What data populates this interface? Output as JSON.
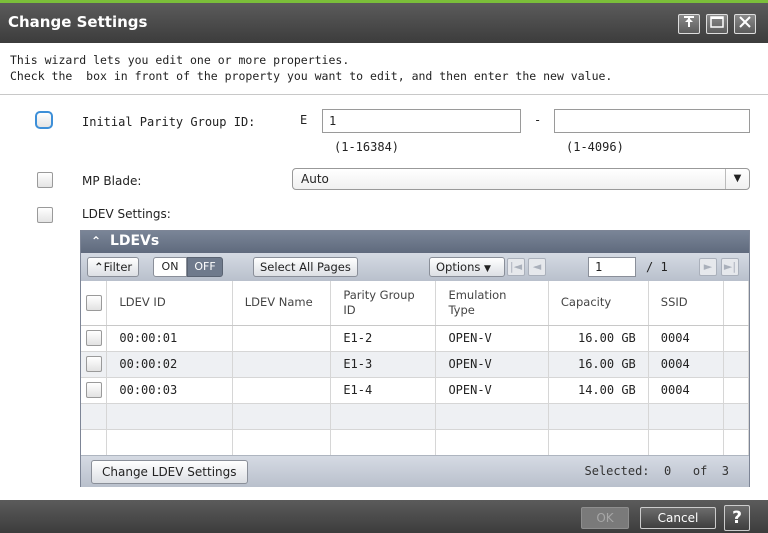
{
  "window": {
    "title": "Change Settings",
    "pin_icon": "pin-icon",
    "maximize_icon": "maximize-icon",
    "close_icon": "close-icon",
    "accent_color": "#7bbf3a"
  },
  "intro": {
    "line1": "This wizard lets you edit one or more properties.",
    "line2": "Check the  box in front of the property you want to edit, and then enter the new value."
  },
  "parity": {
    "label": "Initial Parity Group ID:",
    "prefix": "E",
    "first_value": "1",
    "first_range": "(1-16384)",
    "separator": "-",
    "second_value": "",
    "second_range": "(1-4096)"
  },
  "mp_blade": {
    "label": "MP Blade:",
    "value": "Auto"
  },
  "ldev_settings": {
    "label": "LDEV Settings:"
  },
  "ldevs": {
    "title": "LDEVs",
    "toolbar": {
      "filter": "Filter",
      "on": "ON",
      "off": "OFF",
      "select_all": "Select All Pages",
      "options": "Options",
      "page": "1",
      "page_total": "/ 1"
    },
    "columns": [
      "LDEV ID",
      "LDEV Name",
      "Parity Group ID",
      "Emulation Type",
      "Capacity",
      "SSID"
    ],
    "rows": [
      {
        "id": "00:00:01",
        "name": "",
        "pg": "E1-2",
        "emu": "OPEN-V",
        "cap": "16.00 GB",
        "ssid": "0004"
      },
      {
        "id": "00:00:02",
        "name": "",
        "pg": "E1-3",
        "emu": "OPEN-V",
        "cap": "16.00 GB",
        "ssid": "0004"
      },
      {
        "id": "00:00:03",
        "name": "",
        "pg": "E1-4",
        "emu": "OPEN-V",
        "cap": "14.00 GB",
        "ssid": "0004"
      }
    ],
    "change_button": "Change LDEV Settings",
    "selected_text": "Selected:  0   of  3"
  },
  "footer": {
    "ok": "OK",
    "cancel": "Cancel",
    "help": "?"
  }
}
